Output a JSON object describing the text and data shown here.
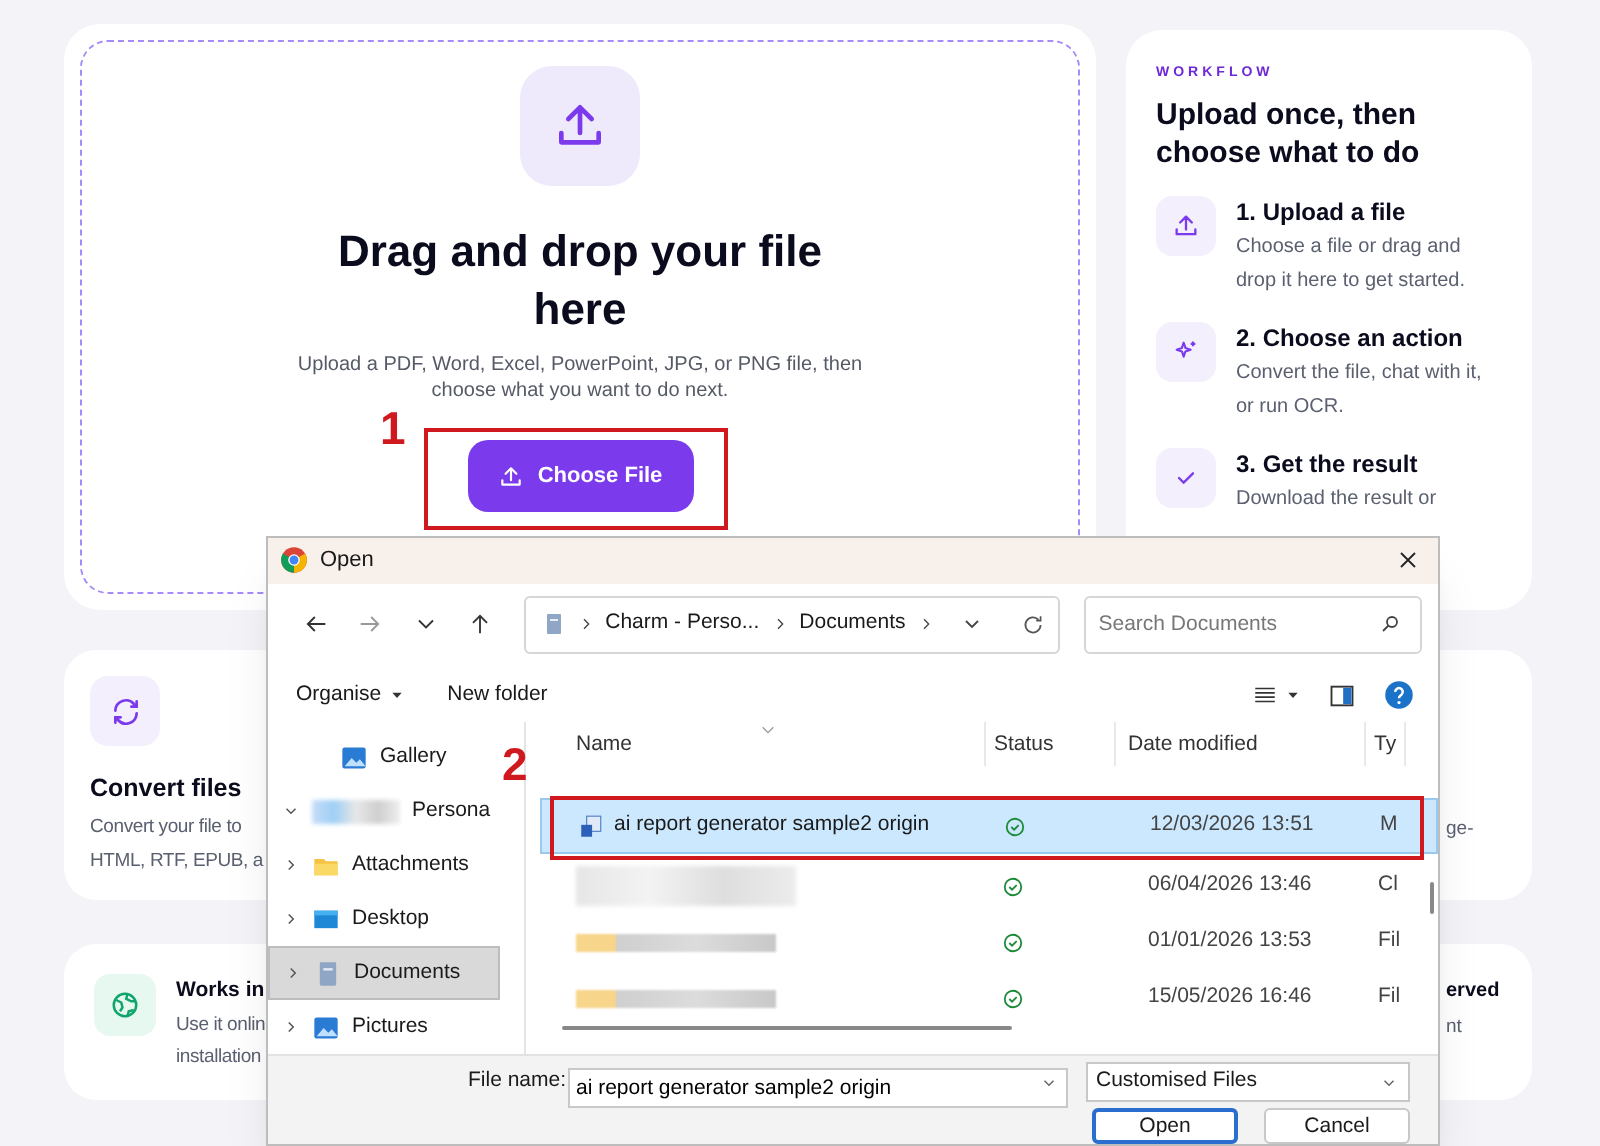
{
  "upload_panel": {
    "heading": "Drag and drop your file here",
    "description": "Upload a PDF, Word, Excel, PowerPoint, JPG, or PNG file, then choose what you want to do next.",
    "button": "Choose File"
  },
  "workflow": {
    "eyebrow": "WORKFLOW",
    "title": "Upload once, then choose what to do",
    "steps": [
      {
        "kind": "upload",
        "title": "1. Upload a file",
        "lines": [
          "Choose a file or drag and",
          "drop it here to get started."
        ]
      },
      {
        "kind": "sparkle",
        "title": "2. Choose an action",
        "lines": [
          "Convert the file, chat with it,",
          "or run OCR."
        ]
      },
      {
        "kind": "check",
        "title": "3. Get the result",
        "lines": [
          "Download the result or"
        ]
      }
    ]
  },
  "features": [
    {
      "kind": "convert",
      "title": "Convert files",
      "lines": [
        "Convert your file to",
        "HTML, RTF, EPUB, a"
      ],
      "side_lines": [
        "ge-"
      ]
    },
    {
      "kind": "globe",
      "title": "Works in",
      "lines": [
        "Use it onlin",
        "installation"
      ],
      "side_title": "erved",
      "side_lines": [
        "nt"
      ]
    }
  ],
  "annotations": [
    {
      "label": "1"
    },
    {
      "label": "2"
    }
  ],
  "dialog": {
    "title": "Open",
    "breadcrumb": [
      "Charm - Perso...",
      "Documents"
    ],
    "search": {
      "placeholder": "Search Documents"
    },
    "toolbar": {
      "organise": "Organise",
      "new_folder": "New folder"
    },
    "nav_items": [
      {
        "kind": "gallery",
        "label": "Gallery",
        "selected": false
      },
      {
        "kind": "account",
        "label": "Persona",
        "expanded": true,
        "selected": false
      },
      {
        "kind": "folder",
        "label": "Attachments",
        "expanded": false,
        "selected": false
      },
      {
        "kind": "desktop",
        "label": "Desktop",
        "expanded": false,
        "selected": false
      },
      {
        "kind": "documents",
        "label": "Documents",
        "expanded": false,
        "selected": true
      },
      {
        "kind": "pictures",
        "label": "Pictures",
        "expanded": false,
        "selected": false
      }
    ],
    "columns": [
      "Name",
      "Status",
      "Date modified",
      "Ty"
    ],
    "files": [
      {
        "kind": "file",
        "name": "ai report generator sample2 origin",
        "synced": true,
        "date": "12/03/2026 13:51",
        "type": "M",
        "selected": true
      },
      {
        "kind": "redacted_file",
        "synced": true,
        "date": "06/04/2026 13:46",
        "type": "Cl",
        "selected": false
      },
      {
        "kind": "redacted_folder",
        "synced": true,
        "date": "01/01/2026 13:53",
        "type": "Fil",
        "selected": false
      },
      {
        "kind": "redacted_folder",
        "synced": true,
        "date": "15/05/2026 16:46",
        "type": "Fil",
        "selected": false
      }
    ],
    "file_name_label": "File name:",
    "file_name": "ai report generator sample2 origin",
    "filter": "Customised Files",
    "buttons": [
      "Open",
      "Cancel"
    ]
  }
}
